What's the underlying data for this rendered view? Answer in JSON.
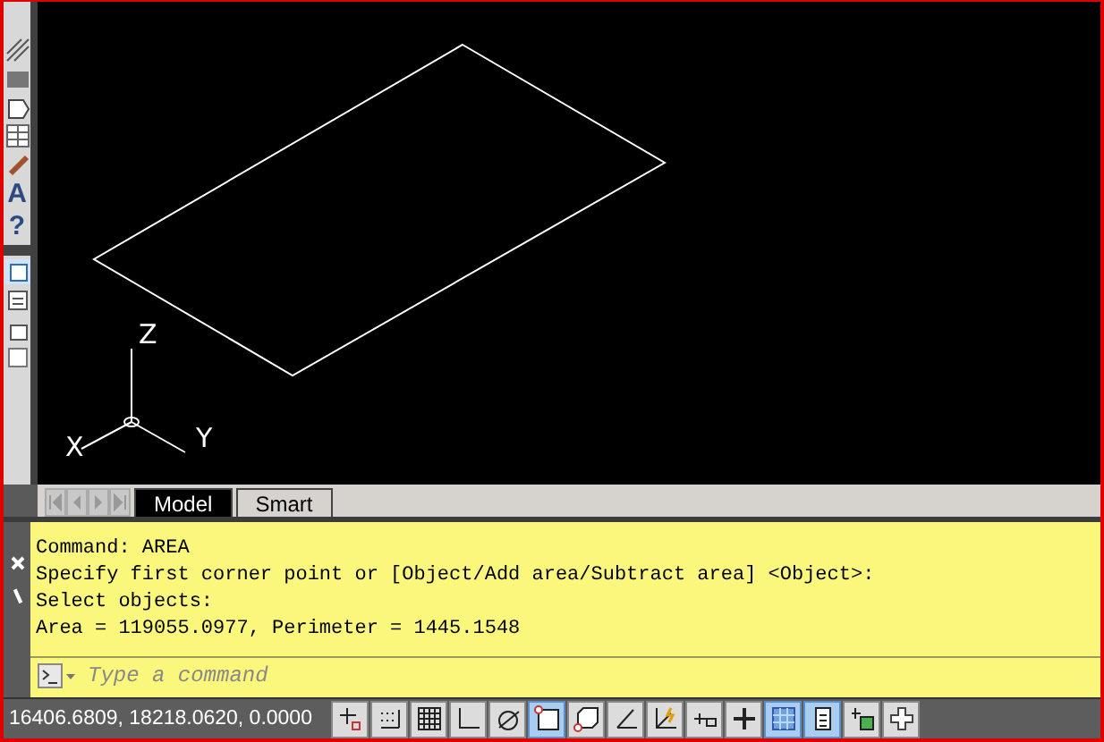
{
  "toolbar": {
    "glyphs": [
      "A",
      "?"
    ]
  },
  "ucs": {
    "x_label": "X",
    "y_label": "Y",
    "z_label": "Z"
  },
  "layout_tabs": [
    {
      "label": "Model",
      "selected": true
    },
    {
      "label": "Smart",
      "selected": false
    }
  ],
  "command_history": [
    "Command: AREA",
    "Specify first corner point or [Object/Add area/Subtract area] <Object>:",
    "Select objects:",
    "Area = 119055.0977, Perimeter = 1445.1548"
  ],
  "command_input": {
    "placeholder": "Type a command"
  },
  "status_bar": {
    "coordinates": "16406.6809, 18218.0620, 0.0000",
    "toggles": [
      {
        "kind": "infer",
        "on": false
      },
      {
        "kind": "snap",
        "on": false
      },
      {
        "kind": "grid",
        "on": false
      },
      {
        "kind": "ortho",
        "on": false
      },
      {
        "kind": "polar",
        "on": false
      },
      {
        "kind": "osnap",
        "on": true
      },
      {
        "kind": "osnap3d",
        "on": false
      },
      {
        "kind": "otrack",
        "on": false
      },
      {
        "kind": "ducs",
        "on": false
      },
      {
        "kind": "dyn",
        "on": false
      },
      {
        "kind": "lineweight",
        "on": false
      },
      {
        "kind": "transparency",
        "on": true
      },
      {
        "kind": "properties",
        "on": true
      },
      {
        "kind": "cycling",
        "on": false
      },
      {
        "kind": "annotation",
        "on": false
      }
    ]
  }
}
